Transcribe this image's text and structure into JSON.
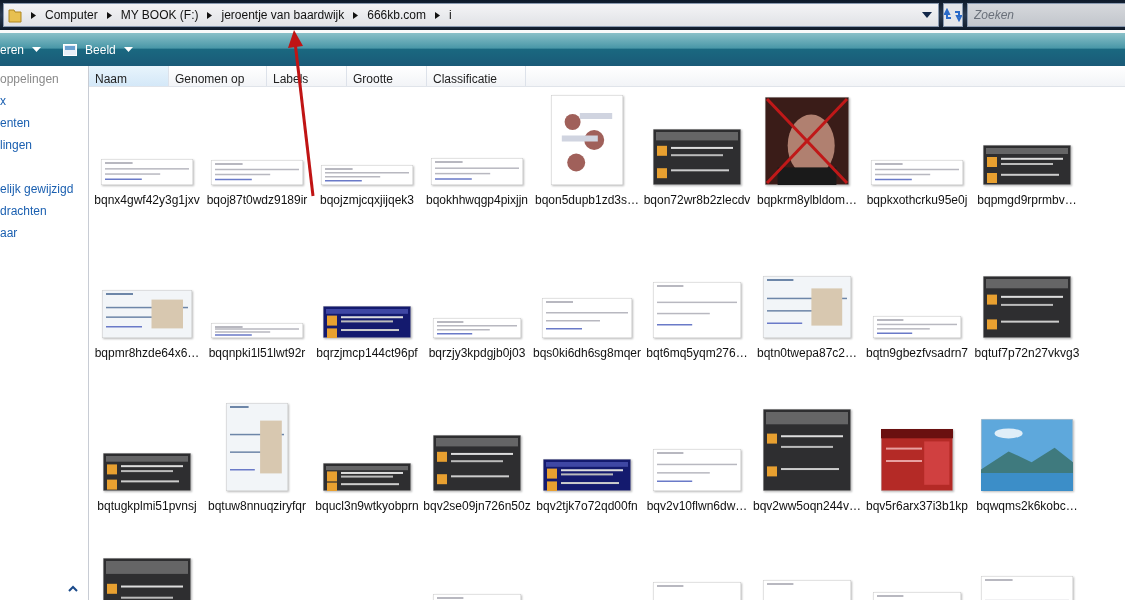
{
  "address_bar": {
    "crumbs": [
      "Computer",
      "MY BOOK (F:)",
      "jeroentje van baardwijk",
      "666kb.com",
      "i"
    ]
  },
  "search": {
    "placeholder": "Zoeken"
  },
  "toolbar": {
    "items": [
      {
        "label": "eren",
        "kind": "menu"
      },
      {
        "label": "Beeld",
        "kind": "view"
      }
    ]
  },
  "sidebar": {
    "header": "oppelingen",
    "items": [
      "x",
      "enten",
      "lingen",
      "elijk gewijzigd",
      "drachten",
      "aar"
    ]
  },
  "columns": [
    {
      "label": "Naam",
      "selected": true
    },
    {
      "label": "Genomen op",
      "selected": false
    },
    {
      "label": "Labels",
      "selected": false
    },
    {
      "label": "Grootte",
      "selected": false
    },
    {
      "label": "Classificatie",
      "selected": false
    }
  ],
  "files": [
    {
      "name": "bqnx4gwf42y3g1jxv",
      "kind": "doc"
    },
    {
      "name": "bqoj87t0wdz9189ir",
      "kind": "doc"
    },
    {
      "name": "bqojzmjcqxjijqek3",
      "kind": "doc"
    },
    {
      "name": "bqokhhwqgp4pixjjn",
      "kind": "doc"
    },
    {
      "name": "bqon5dupb1zd3s…",
      "kind": "collage"
    },
    {
      "name": "bqon72wr8b2zlecdv",
      "kind": "dark"
    },
    {
      "name": "bqpkrm8ylbldom…",
      "kind": "crossed"
    },
    {
      "name": "bqpkxothcrku95e0j",
      "kind": "doc"
    },
    {
      "name": "bqpmgd9rprmbv…",
      "kind": "dark"
    },
    {
      "name": "bqpmr8hzde64x6…",
      "kind": "screen"
    },
    {
      "name": "bqqnpki1l51lwt92r",
      "kind": "doc"
    },
    {
      "name": "bqrzjmcp144ct96pf",
      "kind": "blue"
    },
    {
      "name": "bqrzjy3kpdgjb0j03",
      "kind": "doc"
    },
    {
      "name": "bqs0ki6dh6sg8mqer",
      "kind": "doc"
    },
    {
      "name": "bqt6mq5yqm276…",
      "kind": "doc"
    },
    {
      "name": "bqtn0twepa87c2…",
      "kind": "screen"
    },
    {
      "name": "bqtn9gbezfvsadrn7",
      "kind": "doc"
    },
    {
      "name": "bqtuf7p72n27vkvg3",
      "kind": "dark"
    },
    {
      "name": "bqtugkplmi51pvnsj",
      "kind": "dark"
    },
    {
      "name": "bqtuw8nnuqziryfqr",
      "kind": "screen"
    },
    {
      "name": "bqucl3n9wtkyobprn",
      "kind": "dark"
    },
    {
      "name": "bqv2se09jn726n50z",
      "kind": "dark"
    },
    {
      "name": "bqv2tjk7o72qd00fn",
      "kind": "blue"
    },
    {
      "name": "bqv2v10flwn6dw…",
      "kind": "doc"
    },
    {
      "name": "bqv2ww5oqn244v…",
      "kind": "dark"
    },
    {
      "name": "bqv5r6arx37i3b1kp",
      "kind": "red"
    },
    {
      "name": "bqwqms2k6kobc…",
      "kind": "sky"
    }
  ],
  "more_thumbnails": [
    {
      "kind": "dark"
    },
    {
      "kind": "doc"
    },
    {
      "kind": "doc"
    },
    {
      "kind": "doc"
    },
    {
      "kind": "doc"
    },
    {
      "kind": "doc"
    }
  ]
}
